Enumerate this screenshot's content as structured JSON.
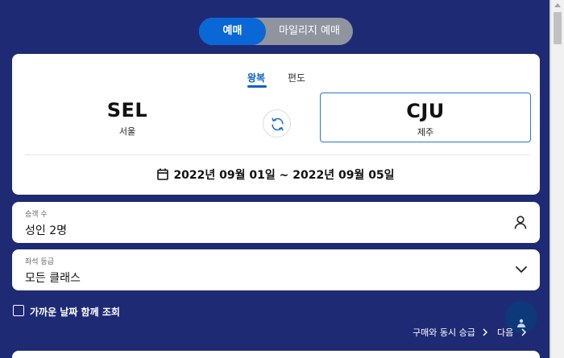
{
  "tabs": {
    "active": "예매",
    "inactive": "마일리지 예매"
  },
  "trip_type": {
    "round_trip": "왕복",
    "one_way": "편도"
  },
  "route": {
    "origin_code": "SEL",
    "origin_city": "서울",
    "destination_code": "CJU",
    "destination_city": "제주"
  },
  "dates": {
    "range": "2022년 09월 01일 ~ 2022년 09월 05일"
  },
  "passengers": {
    "label": "승객 수",
    "value": "성인 2명"
  },
  "seat_class": {
    "label": "좌석 등급",
    "value": "모든 클래스"
  },
  "options": {
    "nearby_dates_label": "가까운 날짜 함께 조회"
  },
  "links": {
    "upgrade": "구매와 동시 승급",
    "next": "다음"
  },
  "colors": {
    "background": "#1e2a74",
    "accent": "#0a67d6",
    "selected_border": "#2a76c6"
  }
}
